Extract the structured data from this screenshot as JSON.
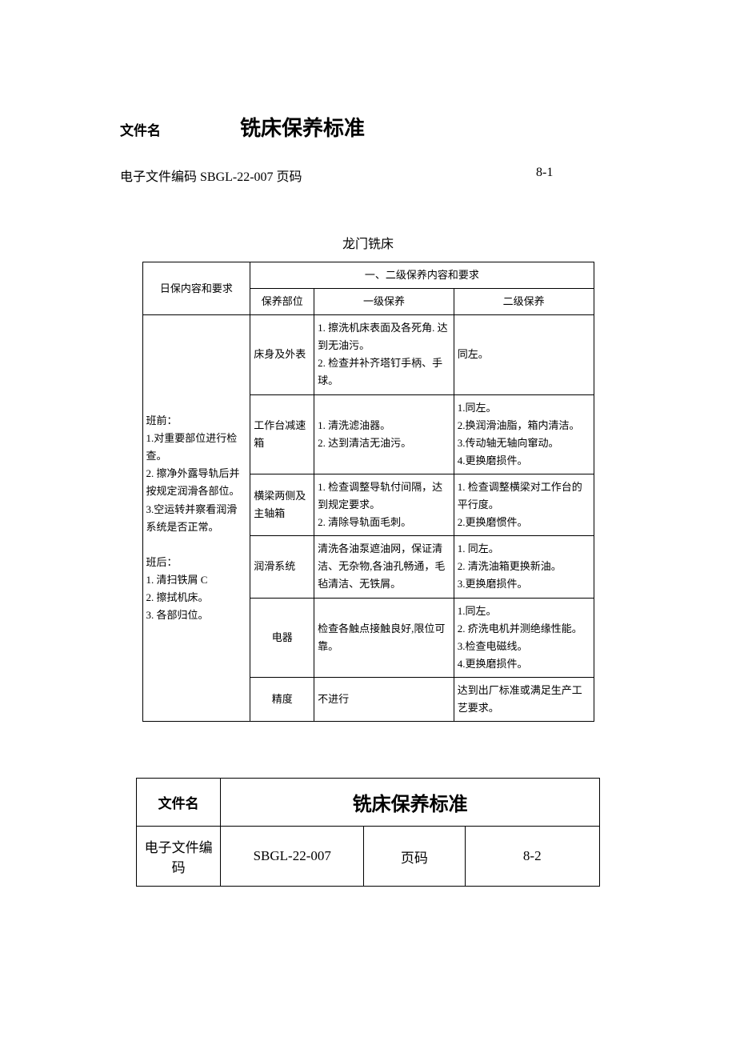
{
  "header": {
    "file_label": "文件名",
    "title": "铣床保养标准",
    "meta_left": "电子文件编码 SBGL-22-007 页码",
    "meta_right": "8-1"
  },
  "sub_title": "龙门铣床",
  "table": {
    "head": {
      "daily": "日保内容和要求",
      "group": "一、二级保养内容和要求",
      "part": "保养部位",
      "l1": "一级保养",
      "l2": "二级保养"
    },
    "daily_content": "班前：\n1.对重要部位进行检查。\n2. 擦净外露导轨后并按规定润滑各部位。\n3.空运转并察看润滑系统是否正常。\n\n班后：\n1. 清扫铁屑 C\n2. 擦拭机床。\n3. 各部归位。",
    "rows": [
      {
        "part": "床身及外表",
        "l1": "1. 擦洗机床表面及各死角. 达到无油污。\n2. 检查并补齐塔钉手柄、手球。",
        "l2": "同左。"
      },
      {
        "part": "工作台减速箱",
        "l1": "1. 清洗滤油器。\n2. 达到清洁无油污。",
        "l2": "1.同左。\n2.换润滑油脂，箱内清洁。\n3.传动轴无轴向窜动。\n4.更换磨损件。"
      },
      {
        "part": "横梁两侧及主轴箱",
        "l1": "1. 检查调整导轨付间隔，达到规定要求。\n2. 清除导轨面毛刺。",
        "l2": "1. 检查调整横梁对工作台的平行度。\n2.更换磨惯件。"
      },
      {
        "part": "润滑系统",
        "l1": "清洗各油泵遮油网，保证清洁、无杂物,各油孔畅通，毛毡清洁、无铁屑。",
        "l2": "1. 同左。\n2. 清洗油箱更换新油。\n3.更换磨损件。"
      },
      {
        "part": "电器",
        "l1": "检查各触点接触良好,限位可靠。",
        "l2": "1.同左。\n2. 疥洗电机并测绝缘性能。\n3.检查电磁线。\n4.更换磨损件。"
      },
      {
        "part": "精度",
        "l1": "不进行",
        "l2": "达到出厂标准或满足生产工艺要求。"
      }
    ]
  },
  "footer": {
    "file_label": "文件名",
    "title": "铣床保养标准",
    "code_label": "电子文件编码",
    "code_value": "SBGL-22-007",
    "page_label": "页码",
    "page_value": "8-2"
  }
}
